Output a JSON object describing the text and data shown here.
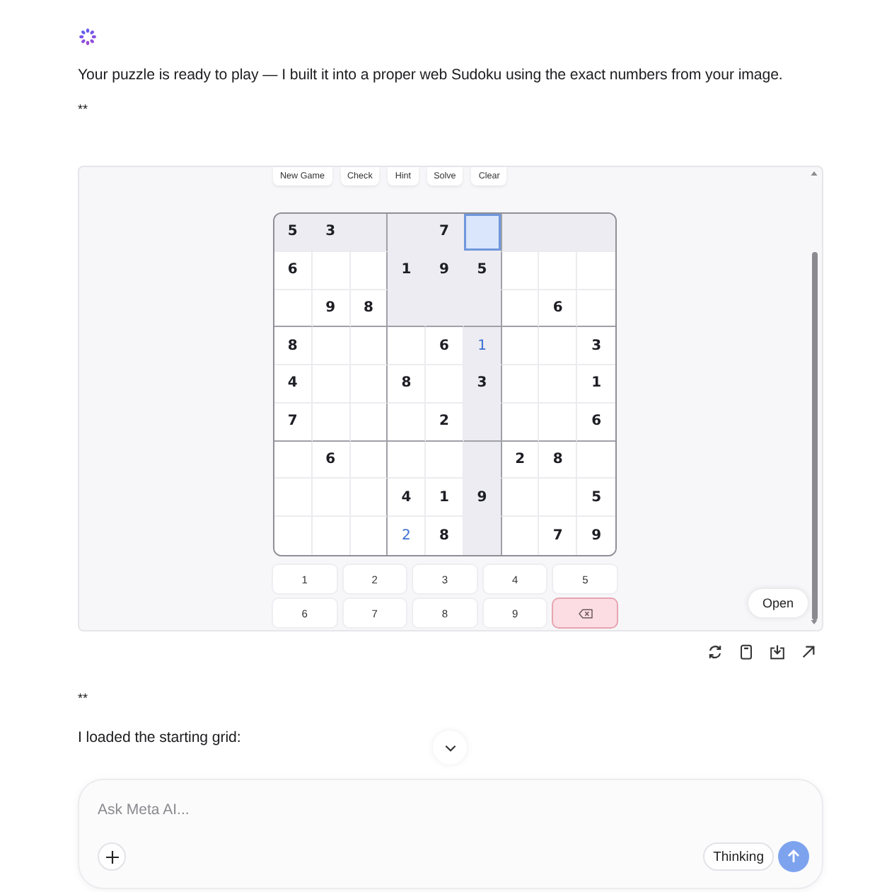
{
  "message": {
    "paragraph": "Your puzzle is ready to play — I built it into a proper web Sudoku using the exact numbers from your image.",
    "separator": "**"
  },
  "sudoku_panel": {
    "toolbar": [
      "New Game",
      "Check",
      "Hint",
      "Solve",
      "Clear"
    ],
    "grid": {
      "rows": [
        [
          {
            "value": "5",
            "kind": "given",
            "selected": false
          },
          {
            "value": "3",
            "kind": "given",
            "selected": false
          },
          {
            "kind": "empty",
            "selected": false
          },
          {
            "kind": "empty",
            "selected": false
          },
          {
            "value": "7",
            "kind": "given",
            "selected": false
          },
          {
            "kind": "empty",
            "selected": true
          },
          {
            "kind": "empty",
            "selected": false
          },
          {
            "kind": "empty",
            "selected": false
          },
          {
            "kind": "empty",
            "selected": false
          }
        ],
        [
          {
            "value": "6",
            "kind": "given",
            "selected": false
          },
          {
            "kind": "empty",
            "selected": false
          },
          {
            "kind": "empty",
            "selected": false
          },
          {
            "value": "1",
            "kind": "given",
            "selected": false
          },
          {
            "value": "9",
            "kind": "given",
            "selected": false
          },
          {
            "value": "5",
            "kind": "given",
            "selected": false
          },
          {
            "kind": "empty",
            "selected": false
          },
          {
            "kind": "empty",
            "selected": false
          },
          {
            "kind": "empty",
            "selected": false
          }
        ],
        [
          {
            "kind": "empty",
            "selected": false
          },
          {
            "value": "9",
            "kind": "given",
            "selected": false
          },
          {
            "value": "8",
            "kind": "given",
            "selected": false
          },
          {
            "kind": "empty",
            "selected": false
          },
          {
            "kind": "empty",
            "selected": false
          },
          {
            "kind": "empty",
            "selected": false
          },
          {
            "kind": "empty",
            "selected": false
          },
          {
            "value": "6",
            "kind": "given",
            "selected": false
          },
          {
            "kind": "empty",
            "selected": false
          }
        ],
        [
          {
            "value": "8",
            "kind": "given",
            "selected": false
          },
          {
            "kind": "empty",
            "selected": false
          },
          {
            "kind": "empty",
            "selected": false
          },
          {
            "kind": "empty",
            "selected": false
          },
          {
            "value": "6",
            "kind": "given",
            "selected": false
          },
          {
            "value": "1",
            "kind": "entry",
            "selected": false
          },
          {
            "kind": "empty",
            "selected": false
          },
          {
            "kind": "empty",
            "selected": false
          },
          {
            "value": "3",
            "kind": "given",
            "selected": false
          }
        ],
        [
          {
            "value": "4",
            "kind": "given",
            "selected": false
          },
          {
            "kind": "empty",
            "selected": false
          },
          {
            "kind": "empty",
            "selected": false
          },
          {
            "value": "8",
            "kind": "given",
            "selected": false
          },
          {
            "kind": "empty",
            "selected": false
          },
          {
            "value": "3",
            "kind": "given",
            "selected": false
          },
          {
            "kind": "empty",
            "selected": false
          },
          {
            "kind": "empty",
            "selected": false
          },
          {
            "value": "1",
            "kind": "given",
            "selected": false
          }
        ],
        [
          {
            "value": "7",
            "kind": "given",
            "selected": false
          },
          {
            "kind": "empty",
            "selected": false
          },
          {
            "kind": "empty",
            "selected": false
          },
          {
            "kind": "empty",
            "selected": false
          },
          {
            "value": "2",
            "kind": "given",
            "selected": false
          },
          {
            "kind": "empty",
            "selected": false
          },
          {
            "kind": "empty",
            "selected": false
          },
          {
            "kind": "empty",
            "selected": false
          },
          {
            "value": "6",
            "kind": "given",
            "selected": false
          }
        ],
        [
          {
            "kind": "empty",
            "selected": false
          },
          {
            "value": "6",
            "kind": "given",
            "selected": false
          },
          {
            "kind": "empty",
            "selected": false
          },
          {
            "kind": "empty",
            "selected": false
          },
          {
            "kind": "empty",
            "selected": false
          },
          {
            "kind": "empty",
            "selected": false
          },
          {
            "value": "2",
            "kind": "given",
            "selected": false
          },
          {
            "value": "8",
            "kind": "given",
            "selected": false
          },
          {
            "kind": "empty",
            "selected": false
          }
        ],
        [
          {
            "kind": "empty",
            "selected": false
          },
          {
            "kind": "empty",
            "selected": false
          },
          {
            "kind": "empty",
            "selected": false
          },
          {
            "value": "4",
            "kind": "given",
            "selected": false
          },
          {
            "value": "1",
            "kind": "given",
            "selected": false
          },
          {
            "value": "9",
            "kind": "given",
            "selected": false
          },
          {
            "kind": "empty",
            "selected": false
          },
          {
            "kind": "empty",
            "selected": false
          },
          {
            "value": "5",
            "kind": "given",
            "selected": false
          }
        ],
        [
          {
            "kind": "empty",
            "selected": false
          },
          {
            "kind": "empty",
            "selected": false
          },
          {
            "kind": "empty",
            "selected": false
          },
          {
            "value": "2",
            "kind": "entry",
            "selected": false
          },
          {
            "value": "8",
            "kind": "given",
            "selected": false
          },
          {
            "kind": "empty",
            "selected": false
          },
          {
            "kind": "empty",
            "selected": false
          },
          {
            "value": "7",
            "kind": "given",
            "selected": false
          },
          {
            "value": "9",
            "kind": "given",
            "selected": false
          }
        ]
      ]
    },
    "keypad": [
      {
        "kind": "digit",
        "label": "1"
      },
      {
        "kind": "digit",
        "label": "2"
      },
      {
        "kind": "digit",
        "label": "3"
      },
      {
        "kind": "digit",
        "label": "4"
      },
      {
        "kind": "digit",
        "label": "5"
      },
      {
        "kind": "digit",
        "label": "6"
      },
      {
        "kind": "digit",
        "label": "7"
      },
      {
        "kind": "digit",
        "label": "8"
      },
      {
        "kind": "digit",
        "label": "9"
      },
      {
        "kind": "erase"
      }
    ],
    "open_button": "Open"
  },
  "followup": {
    "separator": "**",
    "paragraph": "I loaded the starting grid:"
  },
  "composer": {
    "placeholder": "Ask Meta AI...",
    "mode_button": "Thinking"
  }
}
